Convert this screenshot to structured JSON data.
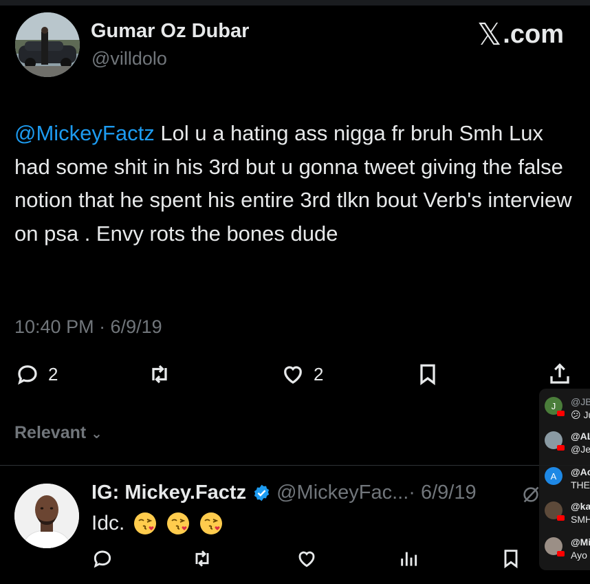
{
  "tweet": {
    "author_name": "Gumar Oz Dubar",
    "author_handle": "@villdolo",
    "brand_x": "𝕏",
    "brand_suffix": ".com",
    "mention": "@MickeyFactz",
    "body": " Lol u a hating ass nigga fr bruh Smh Lux had some shit in his 3rd but u gonna tweet giving the false notion that he spent his entire 3rd tlkn bout Verb's interview on psa . Envy rots the bones dude",
    "timestamp": "10:40 PM · 6/9/19",
    "reply_count": "2",
    "like_count": "2",
    "icons": [
      "reply-icon",
      "retweet-icon",
      "like-icon",
      "bookmark-icon",
      "share-icon"
    ]
  },
  "sort": {
    "label": "Relevant",
    "chevron": "⌄"
  },
  "reply": {
    "name": "IG: Mickey.Factz",
    "handle": "@MickeyFac...",
    "date": " · 6/9/19",
    "text": "Idc.",
    "emoji": "face-blowing-a-kiss",
    "icons": [
      "reply-icon",
      "retweet-icon",
      "like-icon",
      "views-icon",
      "bookmark-icon",
      "share-icon"
    ]
  },
  "live_chat": [
    {
      "user": "@JB",
      "line": "😕 Ju",
      "avatar_letter": "J",
      "avatar_color": "#4a7d3a"
    },
    {
      "user": "@AL",
      "line": "@Je",
      "avatar_letter": "",
      "avatar_color": "#8a9aa3"
    },
    {
      "user": "@Ac",
      "line": "THE",
      "avatar_letter": "A",
      "avatar_color": "#1e88e5"
    },
    {
      "user": "@ka",
      "line": "SMH",
      "avatar_letter": "",
      "avatar_color": "#5d4a3a"
    },
    {
      "user": "@Mi",
      "line": "Ayo",
      "avatar_letter": "",
      "avatar_color": "#9b8f86"
    }
  ],
  "colors": {
    "background": "#000000",
    "text": "#e7e9ea",
    "secondary": "#71767b",
    "mention": "#1d9bf0",
    "verified": "#1d9bf0"
  }
}
